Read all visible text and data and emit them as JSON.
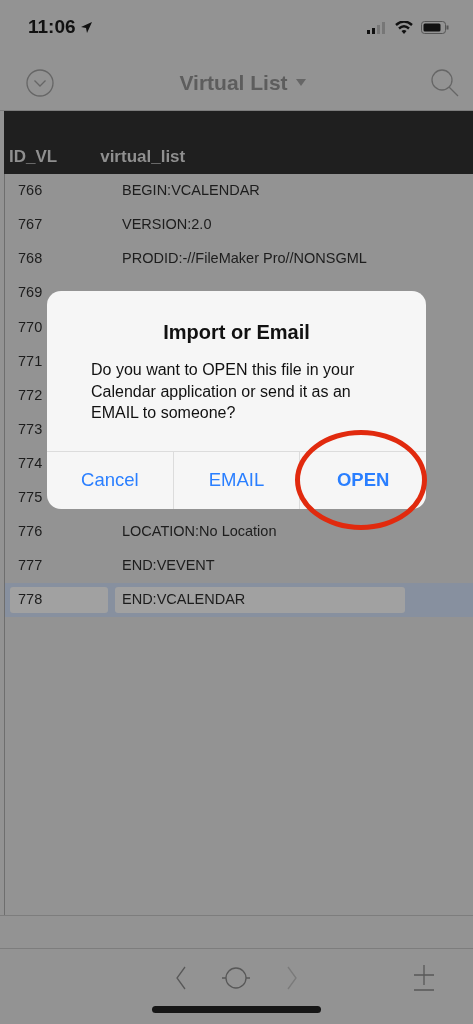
{
  "status_bar": {
    "time": "11:06"
  },
  "nav": {
    "title": "Virtual List"
  },
  "table": {
    "columns": [
      "ID_VL",
      "virtual_list"
    ],
    "rows": [
      {
        "id": "766",
        "value": "BEGIN:VCALENDAR",
        "selected": false
      },
      {
        "id": "767",
        "value": "VERSION:2.0",
        "selected": false
      },
      {
        "id": "768",
        "value": "PRODID:-//FileMaker Pro//NONSGML",
        "selected": false
      },
      {
        "id": "769",
        "selected": false
      },
      {
        "id": "770",
        "selected": false
      },
      {
        "id": "771",
        "selected": false
      },
      {
        "id": "772",
        "selected": false
      },
      {
        "id": "773",
        "selected": false
      },
      {
        "id": "774",
        "selected": false
      },
      {
        "id": "775",
        "selected": false
      },
      {
        "id": "776",
        "value": "LOCATION:No Location",
        "selected": false
      },
      {
        "id": "777",
        "value": "END:VEVENT",
        "selected": false
      },
      {
        "id": "778",
        "value": "END:VCALENDAR",
        "selected": true
      }
    ]
  },
  "dialog": {
    "title": "Import or Email",
    "message": "Do you want to OPEN this file in your Calendar application or send it as an EMAIL to someone?",
    "buttons": [
      {
        "label": "Cancel",
        "preferred": false,
        "circled": false
      },
      {
        "label": "EMAIL",
        "preferred": false,
        "circled": false
      },
      {
        "label": "OPEN",
        "preferred": true,
        "circled": true
      }
    ]
  },
  "toolbar": [
    {
      "kind": "back",
      "disabled": false
    },
    {
      "kind": "record",
      "disabled": false
    },
    {
      "kind": "forward",
      "disabled": true
    },
    {
      "kind": "plus-minus",
      "disabled": false
    }
  ]
}
